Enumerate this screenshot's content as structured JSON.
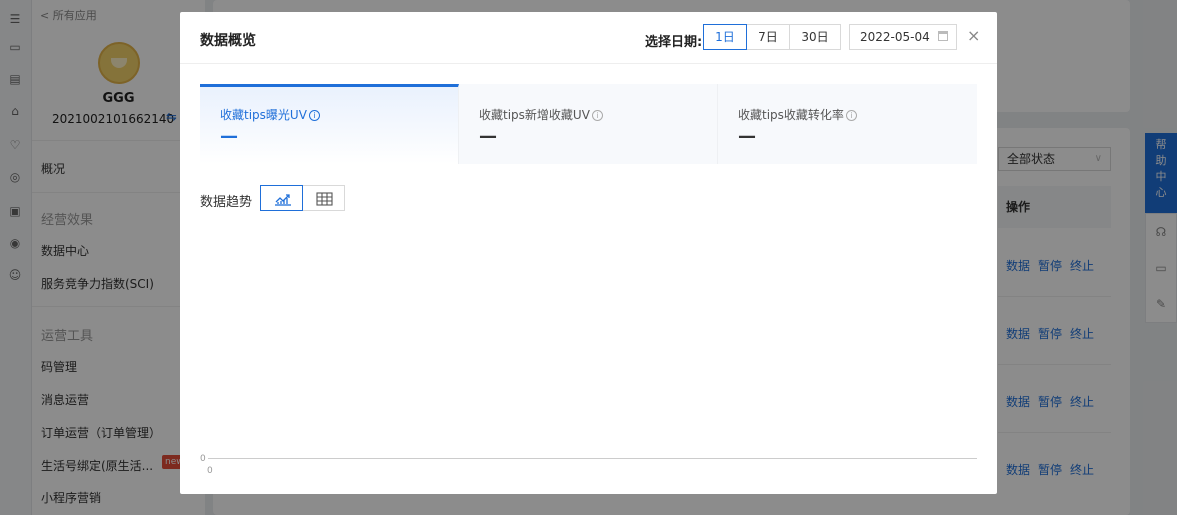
{
  "sidebar": {
    "back_label": "< 所有应用",
    "user_name": "GGG",
    "user_id": "2021002101662140",
    "switch_glyph": "⇋",
    "overview": "概况",
    "groups": [
      {
        "title": "经营效果",
        "items": [
          "数据中心",
          "服务竞争力指数(SCI)"
        ]
      },
      {
        "title": "运营工具",
        "items": [
          "码管理",
          "消息运营",
          "订单运营（订单管理）",
          "生活号绑定(原生活...",
          "小程序营销"
        ]
      }
    ],
    "new_badge": "new"
  },
  "background": {
    "status_select": "全部状态",
    "ops_header": "操作",
    "row_actions": [
      "数据",
      "暂停",
      "终止"
    ]
  },
  "help": {
    "label": "帮助中心"
  },
  "modal": {
    "title": "数据概览",
    "date_label": "选择日期:",
    "date_options": [
      "1日",
      "7日",
      "30日"
    ],
    "date_value": "2022-05-04",
    "close_glyph": "×",
    "metrics": [
      {
        "label": "收藏tips曝光UV",
        "value": "—",
        "info": "i"
      },
      {
        "label": "收藏tips新增收藏UV",
        "value": "—",
        "info": "i"
      },
      {
        "label": "收藏tips收藏转化率",
        "value": "—",
        "info": "i"
      }
    ],
    "trend_label": "数据趋势",
    "view_modes": [
      "line-chart-icon",
      "table-icon"
    ]
  },
  "chart_data": {
    "type": "line",
    "x": [],
    "series": [],
    "y_tick": "0",
    "x_tick": "0",
    "title": "",
    "xlabel": "",
    "ylabel": ""
  },
  "colors": {
    "accent": "#1f6fd9",
    "badge": "#e34d3a"
  }
}
